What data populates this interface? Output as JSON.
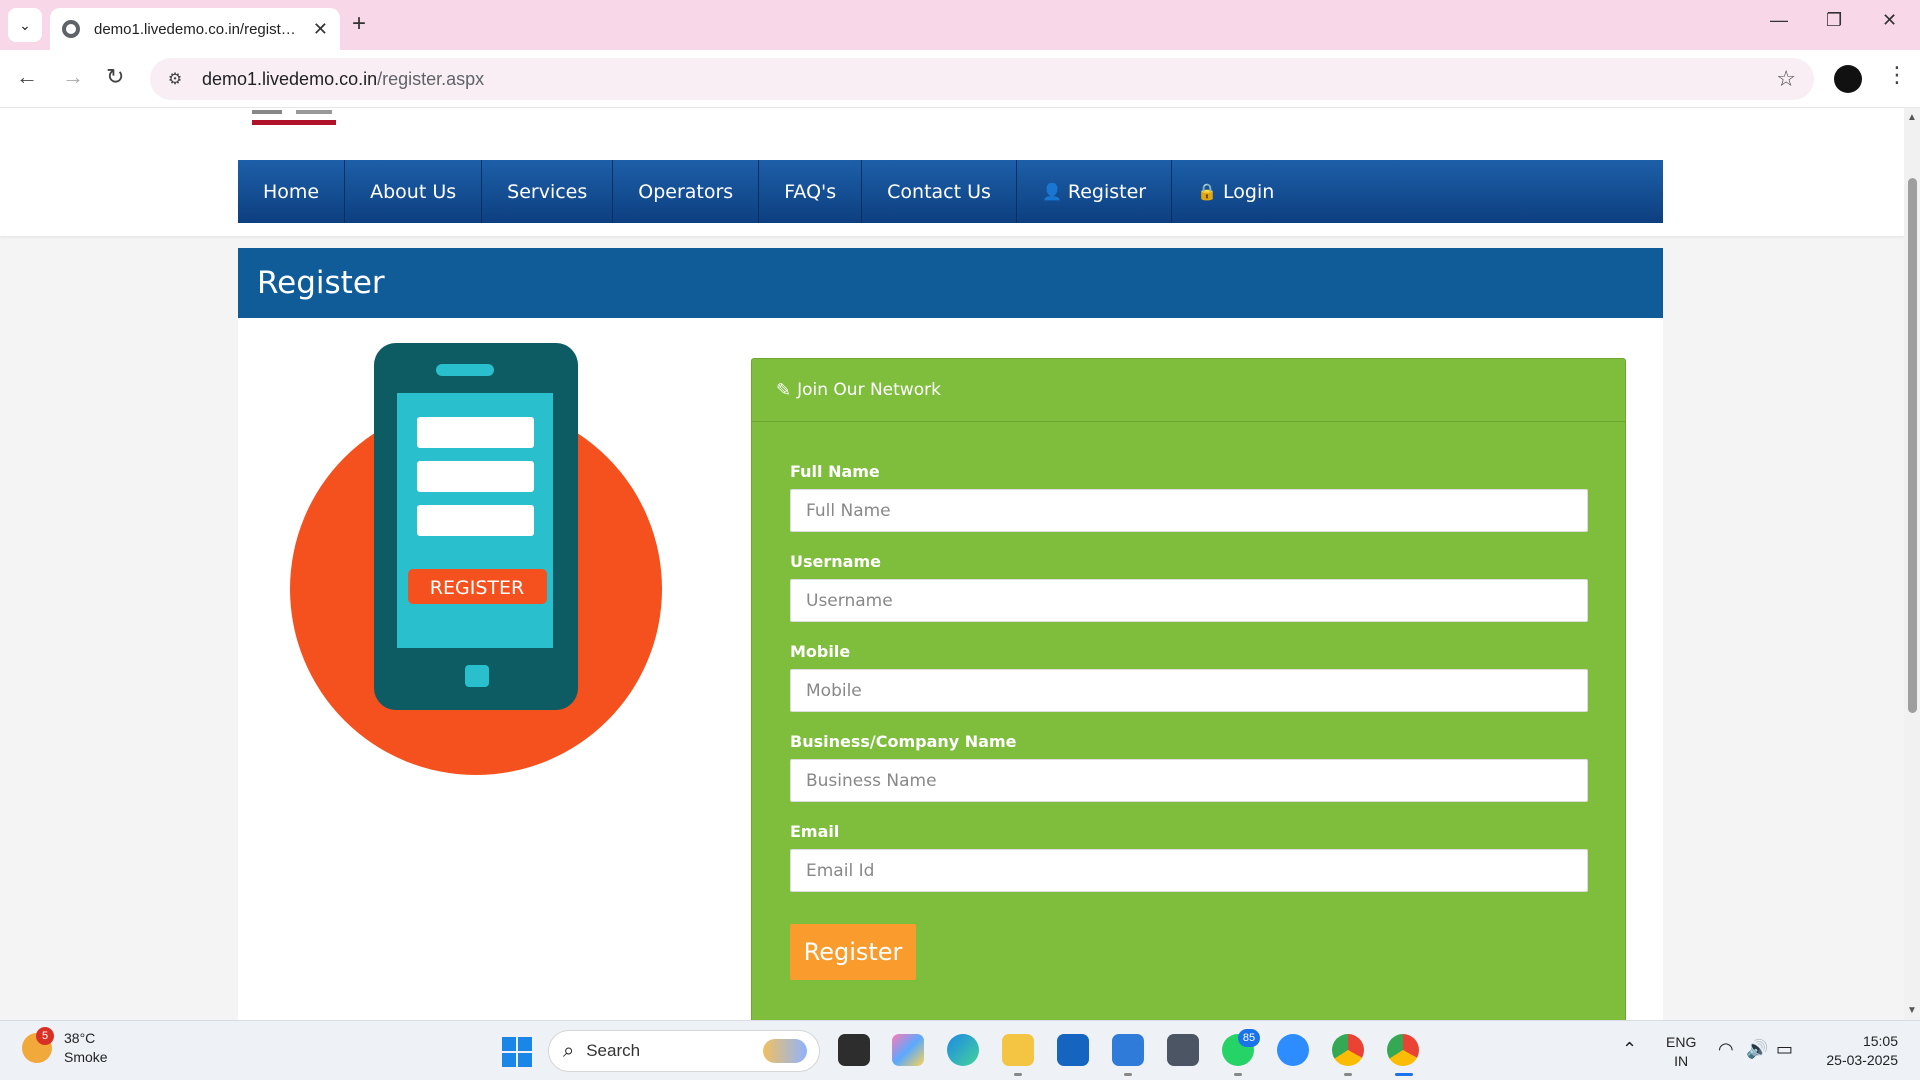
{
  "browser": {
    "tab_title": "demo1.livedemo.co.in/register.aspx",
    "url_host": "demo1.livedemo.co.in",
    "url_path": "/register.aspx"
  },
  "nav": {
    "items": [
      {
        "label": "Home",
        "icon": ""
      },
      {
        "label": "About Us",
        "icon": ""
      },
      {
        "label": "Services",
        "icon": ""
      },
      {
        "label": "Operators",
        "icon": ""
      },
      {
        "label": "FAQ's",
        "icon": ""
      },
      {
        "label": "Contact Us",
        "icon": ""
      },
      {
        "label": "Register",
        "icon": "user-plus-icon"
      },
      {
        "label": "Login",
        "icon": "lock-icon"
      }
    ]
  },
  "page": {
    "title": "Register",
    "illustration_button": "REGISTER"
  },
  "form": {
    "heading": "Join Our Network",
    "fields": [
      {
        "label": "Full Name",
        "placeholder": "Full Name"
      },
      {
        "label": "Username",
        "placeholder": "Username"
      },
      {
        "label": "Mobile",
        "placeholder": "Mobile"
      },
      {
        "label": "Business/Company Name",
        "placeholder": "Business Name"
      },
      {
        "label": "Email",
        "placeholder": "Email Id"
      }
    ],
    "submit_label": "Register"
  },
  "taskbar": {
    "weather_badge": "5",
    "weather_temp": "38°C",
    "weather_desc": "Smoke",
    "search_label": "Search",
    "whatsapp_badge": "85",
    "lang_line1": "ENG",
    "lang_line2": "IN",
    "time": "15:05",
    "date": "25-03-2025"
  },
  "colors": {
    "nav_blue": "#1d5fa8",
    "header_blue": "#0f5c99",
    "form_green": "#7fbd3d",
    "button_orange": "#f99b2d",
    "circle_orange": "#f4511e",
    "phone_teal": "#0d5b63",
    "screen_cyan": "#29bfcc"
  }
}
